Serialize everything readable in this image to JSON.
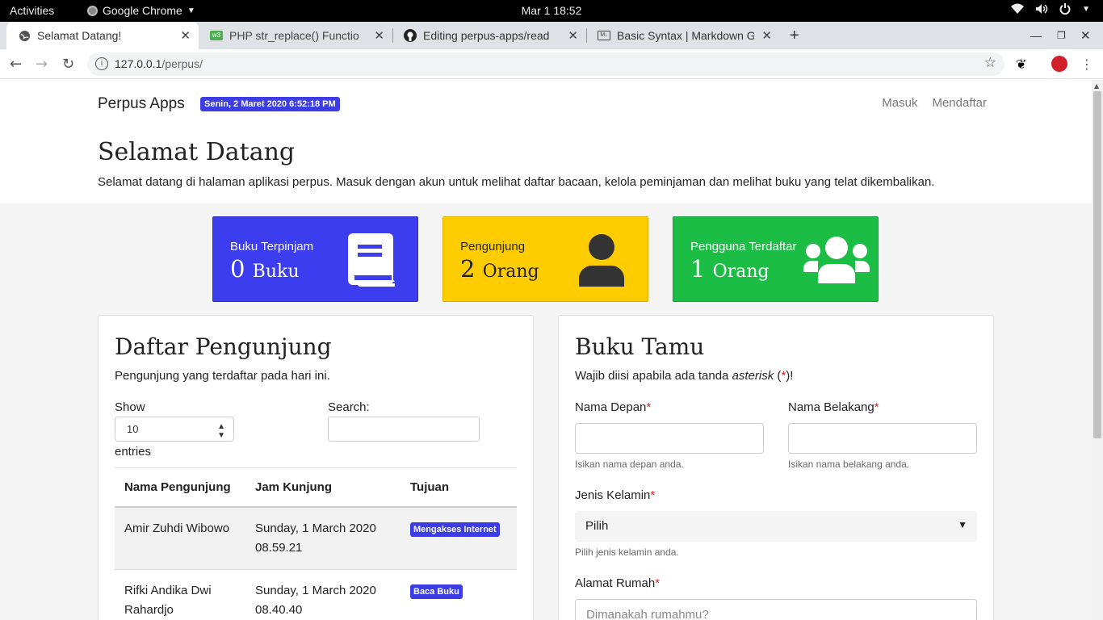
{
  "os": {
    "activities": "Activities",
    "app_name": "Google Chrome",
    "clock": "Mar 1  18:52"
  },
  "tabs": [
    {
      "label": "Selamat Datang!",
      "icon": "globe-icon"
    },
    {
      "label": "PHP str_replace() Functio",
      "icon": "w3-icon"
    },
    {
      "label": "Editing perpus-apps/read",
      "icon": "github-icon"
    },
    {
      "label": "Basic Syntax | Markdown G",
      "icon": "markdown-icon"
    }
  ],
  "address": {
    "host": "127.0.0.1",
    "path": "/perpus/"
  },
  "site": {
    "brand": "Perpus Apps",
    "date_badge": "Senin, 2 Maret 2020 6:52:18 PM",
    "nav": {
      "login": "Masuk",
      "register": "Mendaftar"
    },
    "title": "Selamat Datang",
    "lead": "Selamat datang di halaman aplikasi perpus. Masuk dengan akun untuk melihat daftar bacaan, kelola peminjaman dan melihat buku yang telat dikembalikan."
  },
  "stats": [
    {
      "label": "Buku Terpinjam",
      "value": "0",
      "unit": "Buku",
      "color": "#3d3df0",
      "icon": "book-icon"
    },
    {
      "label": "Pengunjung",
      "value": "2",
      "unit": "Orang",
      "color": "#ffcc00",
      "icon": "user-icon"
    },
    {
      "label": "Pengguna Terdaftar",
      "value": "1",
      "unit": "Orang",
      "color": "#1bbd45",
      "icon": "users-icon"
    }
  ],
  "visitors": {
    "title": "Daftar Pengunjung",
    "subtitle": "Pengunjung yang terdaftar pada hari ini.",
    "show_label": "Show",
    "entries_value": "10",
    "entries_label": "entries",
    "search_label": "Search:",
    "columns": [
      "Nama Pengunjung",
      "Jam Kunjung",
      "Tujuan"
    ],
    "rows": [
      {
        "name": "Amir Zuhdi Wibowo",
        "date": "Sunday, 1 March 2020",
        "time": "08.59.21",
        "purpose": "Mengakses Internet"
      },
      {
        "name": "Rifki Andika Dwi Rahardjo",
        "date": "Sunday, 1 March 2020",
        "time": "08.40.40",
        "purpose": "Baca Buku"
      }
    ]
  },
  "guestbook": {
    "title": "Buku Tamu",
    "note_pre": "Wajib diisi apabila ada tanda ",
    "note_em": "asterisk",
    "note_open": " (",
    "note_star": "*",
    "note_close": ")!",
    "first_name_label": "Nama Depan",
    "first_name_help": "Isikan nama depan anda.",
    "last_name_label": "Nama Belakang",
    "last_name_help": "Isikan nama belakang anda.",
    "gender_label": "Jenis Kelamin",
    "gender_value": "Pilih",
    "gender_help": "Pilih jenis kelamin anda.",
    "address_label": "Alamat Rumah",
    "address_placeholder": "Dimanakah rumahmu?",
    "asterisk": "*"
  }
}
